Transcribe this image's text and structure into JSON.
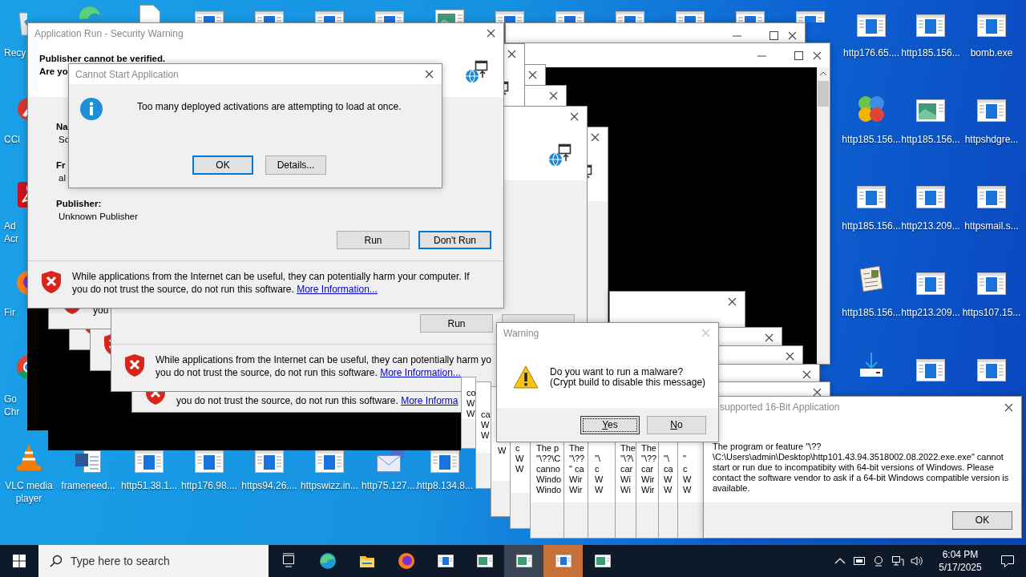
{
  "desktop_icons": [
    {
      "kind": "recycle",
      "label": "Recy"
    },
    {
      "kind": "ccleaner",
      "label": "CCl"
    },
    {
      "kind": "acrobat",
      "label": "Ad Acr"
    },
    {
      "kind": "firefox",
      "label": "Fir"
    },
    {
      "kind": "chrome",
      "label": "Go Chr"
    },
    {
      "kind": "vlc",
      "label": "VLC media player"
    },
    {
      "kind": "word",
      "label": "frameneed..."
    },
    {
      "kind": "app",
      "label": "http51.38.1..."
    },
    {
      "kind": "app",
      "label": "http176.98...."
    },
    {
      "kind": "app",
      "label": "https94.26...."
    },
    {
      "kind": "app",
      "label": "httpswizz.in..."
    },
    {
      "kind": "mail",
      "label": "http75.127...."
    },
    {
      "kind": "app",
      "label": "http8.134.8..."
    },
    {
      "kind": "edge"
    },
    {
      "kind": "file"
    },
    {
      "kind": "app"
    },
    {
      "kind": "app"
    },
    {
      "kind": "app"
    },
    {
      "kind": "app"
    },
    {
      "kind": "photo"
    },
    {
      "kind": "app"
    },
    {
      "kind": "app"
    },
    {
      "kind": "app"
    },
    {
      "kind": "app"
    },
    {
      "kind": "app"
    },
    {
      "kind": "app"
    },
    {
      "kind": "app",
      "label": "http176.65...."
    },
    {
      "kind": "app",
      "label": "http185.156..."
    },
    {
      "kind": "app",
      "label": "bomb.exe"
    },
    {
      "kind": "balls",
      "label": "http185.156..."
    },
    {
      "kind": "photo",
      "label": "http185.156..."
    },
    {
      "kind": "app",
      "label": "httpshdgre..."
    },
    {
      "kind": "app",
      "label": "http185.156..."
    },
    {
      "kind": "app",
      "label": "http213.209..."
    },
    {
      "kind": "app",
      "label": "httpsmail.s..."
    },
    {
      "kind": "newspaper",
      "label": "http185.156..."
    },
    {
      "kind": "app",
      "label": "http213.209..."
    },
    {
      "kind": "app",
      "label": "https107.15..."
    },
    {
      "kind": "download"
    },
    {
      "kind": "app"
    },
    {
      "kind": "app"
    }
  ],
  "security_warning_copies": [
    {
      "footer_line_2": "you"
    },
    {
      "buttons": [
        {
          "label": "Run",
          "focused": false
        }
      ],
      "footer_line_1": "While applications from the Internet can be useful, they can potentially harm yo",
      "footer_line_2": "you do not trust the source, do not run this software.",
      "link": "More Information..."
    },
    {
      "footer_line_2": "you do not trust the source, do not run this software.",
      "link": "More Informa"
    }
  ],
  "security_warning": {
    "title": "Application Run - Security Warning",
    "heading": "Publisher cannot be verified.",
    "question": "Are yo",
    "fields": [
      {
        "label": "Na",
        "value": "So"
      },
      {
        "label": "Fr",
        "value": "al"
      },
      {
        "label": "Publisher:",
        "value": "Unknown Publisher"
      }
    ],
    "buttons": [
      {
        "label": "Run",
        "focused": false
      },
      {
        "label": "Don't Run",
        "focused": true
      }
    ],
    "warning": "While applications from the Internet can be useful, they can potentially harm your computer. If you do not trust the source, do not run this software.",
    "link": "More Information..."
  },
  "cannot_start_dialog": {
    "title": "Cannot Start Application",
    "message": "Too many deployed activations are attempting to load at once.",
    "buttons": [
      {
        "label": "OK",
        "focused": true
      },
      {
        "label": "Details...",
        "focused": false
      }
    ]
  },
  "sixteen_bit_stack": [
    {
      "lines": [
        "co",
        "W",
        "W"
      ]
    },
    {
      "lines": [
        "ca",
        "W",
        "W"
      ]
    },
    {
      "lines": [
        "W"
      ]
    },
    {
      "lines": [
        "c",
        "W",
        "W"
      ]
    },
    {
      "lines": [
        "The p",
        "\"\\??\\C",
        "canno",
        "Windo",
        "Windo"
      ]
    },
    {
      "lines": [
        "The",
        "\"\\??",
        "\" ca",
        "Wir",
        "Wir"
      ]
    },
    {
      "lines": [
        "\"\\",
        "c",
        "W",
        "W"
      ]
    },
    {
      "lines": [
        "The",
        "\"\\?\\",
        "car",
        "Wi",
        "Wi"
      ]
    },
    {
      "lines": [
        "The",
        "\"\\??",
        "car",
        "Wir",
        "Wir"
      ]
    },
    {
      "lines": [
        "\"\\",
        "ca",
        "W",
        "W"
      ]
    },
    {
      "lines": [
        "\"",
        "c",
        "W",
        "W"
      ]
    }
  ],
  "sixteen_bit_dialog": {
    "title": "supported 16-Bit Application",
    "message": "The program or feature \"\\??\\C:\\Users\\admin\\Desktop\\http101.43.94.3518002.08.2022.exe.exe\" cannot start or run due to incompatibity with 64-bit versions of Windows. Please contact the software vendor to ask if a 64-bit Windows compatible version is available.",
    "button": "OK"
  },
  "warning_dialog": {
    "title": "Warning",
    "message": "Do you want to run a malware?\n(Crypt build to disable this message)",
    "buttons": [
      {
        "label": "Yes",
        "focused": true
      },
      {
        "label": "No",
        "focused": false
      }
    ]
  },
  "taskbar": {
    "search": {
      "placeholder": "Type here to search"
    },
    "buttons": [
      {
        "kind": "taskview",
        "active": false,
        "flashing": false
      },
      {
        "kind": "edge",
        "active": false,
        "flashing": false
      },
      {
        "kind": "folder",
        "active": false,
        "flashing": false
      },
      {
        "kind": "firefox",
        "active": false,
        "flashing": false
      },
      {
        "kind": "app",
        "active": false,
        "flashing": false
      },
      {
        "kind": "photo",
        "active": false,
        "flashing": false
      },
      {
        "kind": "photo",
        "active": true,
        "flashing": false
      },
      {
        "kind": "app",
        "active": false,
        "flashing": true
      },
      {
        "kind": "photo",
        "active": false,
        "flashing": false
      }
    ],
    "time": "6:04 PM",
    "date": "5/17/2025"
  }
}
